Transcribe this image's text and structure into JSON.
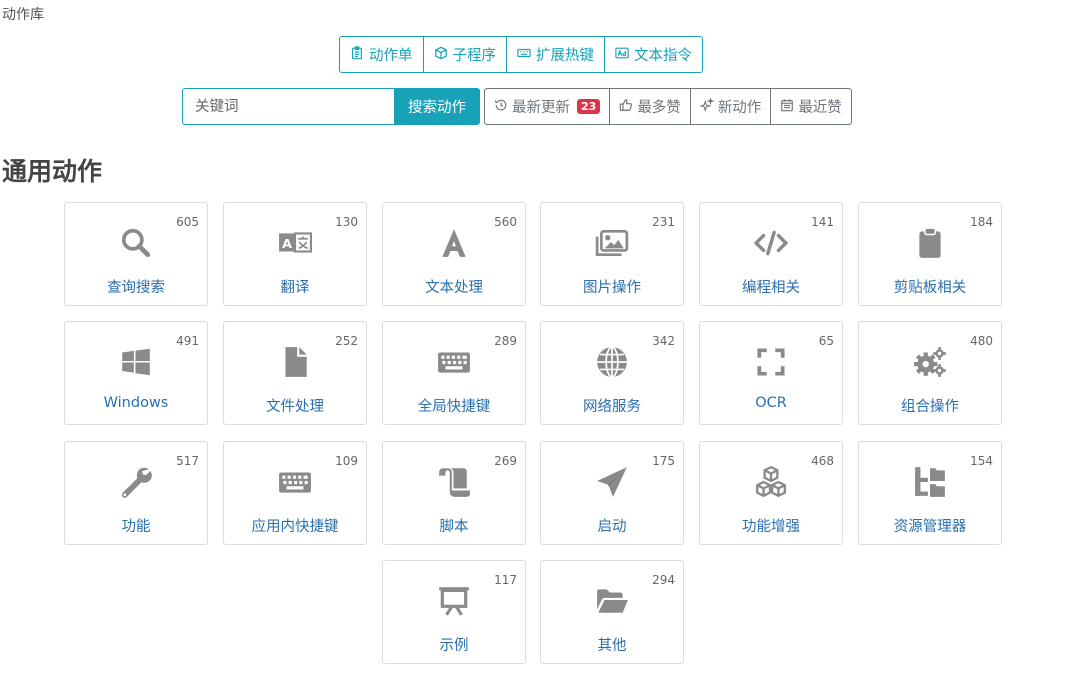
{
  "breadcrumb": "动作库",
  "type_nav": [
    {
      "label": "动作单",
      "icon": "clipboard-list-icon"
    },
    {
      "label": "子程序",
      "icon": "cube-icon"
    },
    {
      "label": "扩展热键",
      "icon": "keyboard-icon"
    },
    {
      "label": "文本指令",
      "icon": "ad-text-icon"
    }
  ],
  "search": {
    "placeholder": "关键词",
    "button_label": "搜索动作"
  },
  "sort_buttons": [
    {
      "label": "最新更新",
      "icon": "history-icon",
      "badge": "23"
    },
    {
      "label": "最多赞",
      "icon": "thumbs-up-icon"
    },
    {
      "label": "新动作",
      "icon": "sparkle-icon"
    },
    {
      "label": "最近赞",
      "icon": "calendar-icon"
    }
  ],
  "section_title": "通用动作",
  "colors": {
    "accent": "#17a2b8",
    "link": "#2a6fb0",
    "badge": "#dc3545",
    "icon": "#8a8a8a"
  },
  "categories": [
    {
      "label": "查询搜索",
      "count": "605",
      "icon": "search-icon"
    },
    {
      "label": "翻译",
      "count": "130",
      "icon": "translate-icon"
    },
    {
      "label": "文本处理",
      "count": "560",
      "icon": "font-icon"
    },
    {
      "label": "图片操作",
      "count": "231",
      "icon": "images-icon"
    },
    {
      "label": "编程相关",
      "count": "141",
      "icon": "code-icon"
    },
    {
      "label": "剪贴板相关",
      "count": "184",
      "icon": "clipboard-icon"
    },
    {
      "label": "Windows",
      "count": "491",
      "icon": "windows-icon"
    },
    {
      "label": "文件处理",
      "count": "252",
      "icon": "file-icon"
    },
    {
      "label": "全局快捷键",
      "count": "289",
      "icon": "keyboard-icon"
    },
    {
      "label": "网络服务",
      "count": "342",
      "icon": "globe-icon"
    },
    {
      "label": "OCR",
      "count": "65",
      "icon": "expand-icon"
    },
    {
      "label": "组合操作",
      "count": "480",
      "icon": "cogs-icon"
    },
    {
      "label": "功能",
      "count": "517",
      "icon": "wrench-icon"
    },
    {
      "label": "应用内快捷键",
      "count": "109",
      "icon": "keyboard-icon"
    },
    {
      "label": "脚本",
      "count": "269",
      "icon": "scroll-icon"
    },
    {
      "label": "启动",
      "count": "175",
      "icon": "paper-plane-icon"
    },
    {
      "label": "功能增强",
      "count": "468",
      "icon": "cubes-icon"
    },
    {
      "label": "资源管理器",
      "count": "154",
      "icon": "sitemap-icon"
    },
    {
      "label": "示例",
      "count": "117",
      "icon": "presentation-icon"
    },
    {
      "label": "其他",
      "count": "294",
      "icon": "folder-open-icon"
    }
  ]
}
